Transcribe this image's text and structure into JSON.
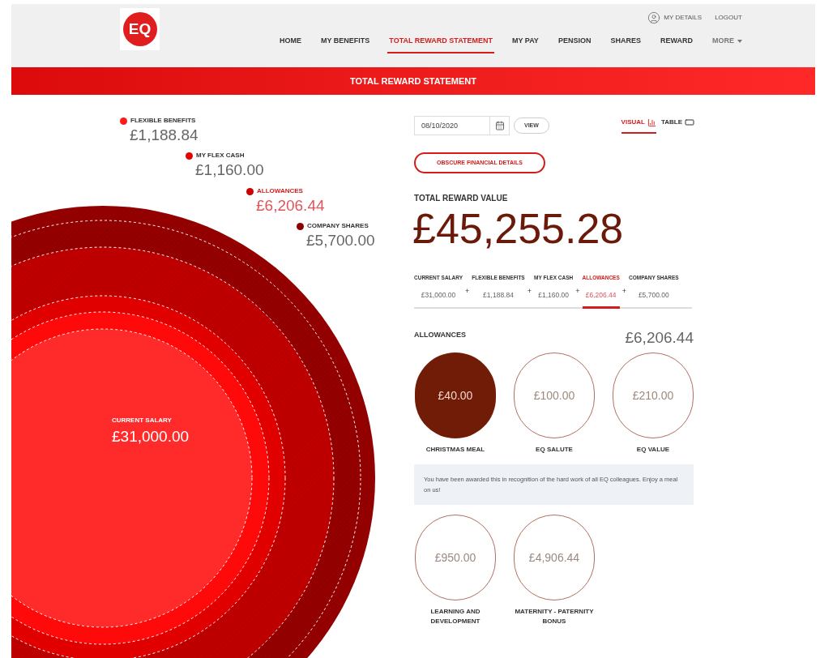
{
  "header": {
    "logo": "EQ",
    "user_links": [
      {
        "label": "MY DETAILS",
        "kind": "user"
      },
      {
        "label": "LOGOUT",
        "kind": "plain"
      }
    ],
    "nav": [
      {
        "label": "HOME",
        "selected": false
      },
      {
        "label": "MY BENEFITS",
        "selected": false
      },
      {
        "label": "TOTAL REWARD STATEMENT",
        "selected": true
      },
      {
        "label": "MY PAY",
        "selected": false
      },
      {
        "label": "PENSION",
        "selected": false
      },
      {
        "label": "SHARES",
        "selected": false
      },
      {
        "label": "REWARD",
        "selected": false
      },
      {
        "label": "MORE",
        "selected": false,
        "dropdown": true
      }
    ]
  },
  "banner": {
    "title": "TOTAL REWARD STATEMENT"
  },
  "legend": [
    {
      "label": "FLEXIBLE BENEFITS",
      "value": "£1,188.84",
      "color": "#ff1a1a",
      "selected": false
    },
    {
      "label": "MY FLEX CASH",
      "value": "£1,160.00",
      "color": "#e60000",
      "selected": false
    },
    {
      "label": "ALLOWANCES",
      "value": "£6,206.44",
      "color": "#cc0000",
      "selected": true
    },
    {
      "label": "COMPANY SHARES",
      "value": "£5,700.00",
      "color": "#8b0000",
      "selected": false
    }
  ],
  "center_label": {
    "label": "CURRENT SALARY",
    "value": "£31,000.00"
  },
  "controls": {
    "date": "08/10/2020",
    "view_button": "VIEW",
    "obscure_button": "OBSCURE FINANCIAL DETAILS",
    "view_modes": [
      {
        "label": "VISUAL",
        "kind": "chart",
        "selected": true
      },
      {
        "label": "TABLE",
        "kind": "table",
        "selected": false
      }
    ]
  },
  "total": {
    "label": "TOTAL REWARD VALUE",
    "value": "£45,255.28"
  },
  "breakdown": [
    {
      "label": "CURRENT SALARY",
      "value": "£31,000.00",
      "selected": false
    },
    {
      "label": "FLEXIBLE BENEFITS",
      "value": "£1,188.84",
      "operator": "+",
      "selected": false
    },
    {
      "label": "MY FLEX CASH",
      "value": "£1,160.00",
      "operator": "+",
      "selected": false
    },
    {
      "label": "ALLOWANCES",
      "value": "£6,206.44",
      "operator": "+",
      "selected": true
    },
    {
      "label": "COMPANY SHARES",
      "value": "£5,700.00",
      "operator": "+",
      "selected": false
    }
  ],
  "allowances": {
    "title": "ALLOWANCES",
    "total": "£6,206.44",
    "items": [
      {
        "label": "CHRISTMAS MEAL",
        "value": "£40.00",
        "selected": true,
        "description": "You have been awarded this in recognition of the hard work of all EQ colleagues. Enjoy a meal on us!"
      },
      {
        "label": "EQ SALUTE",
        "value": "£100.00",
        "selected": false
      },
      {
        "label": "EQ VALUE",
        "value": "£210.00",
        "selected": false
      },
      {
        "label": "LEARNING AND DEVELOPMENT",
        "value": "£950.00",
        "selected": false
      },
      {
        "label": "MATERNITY - PATERNITY BONUS",
        "value": "£4,906.44",
        "selected": false
      }
    ]
  }
}
